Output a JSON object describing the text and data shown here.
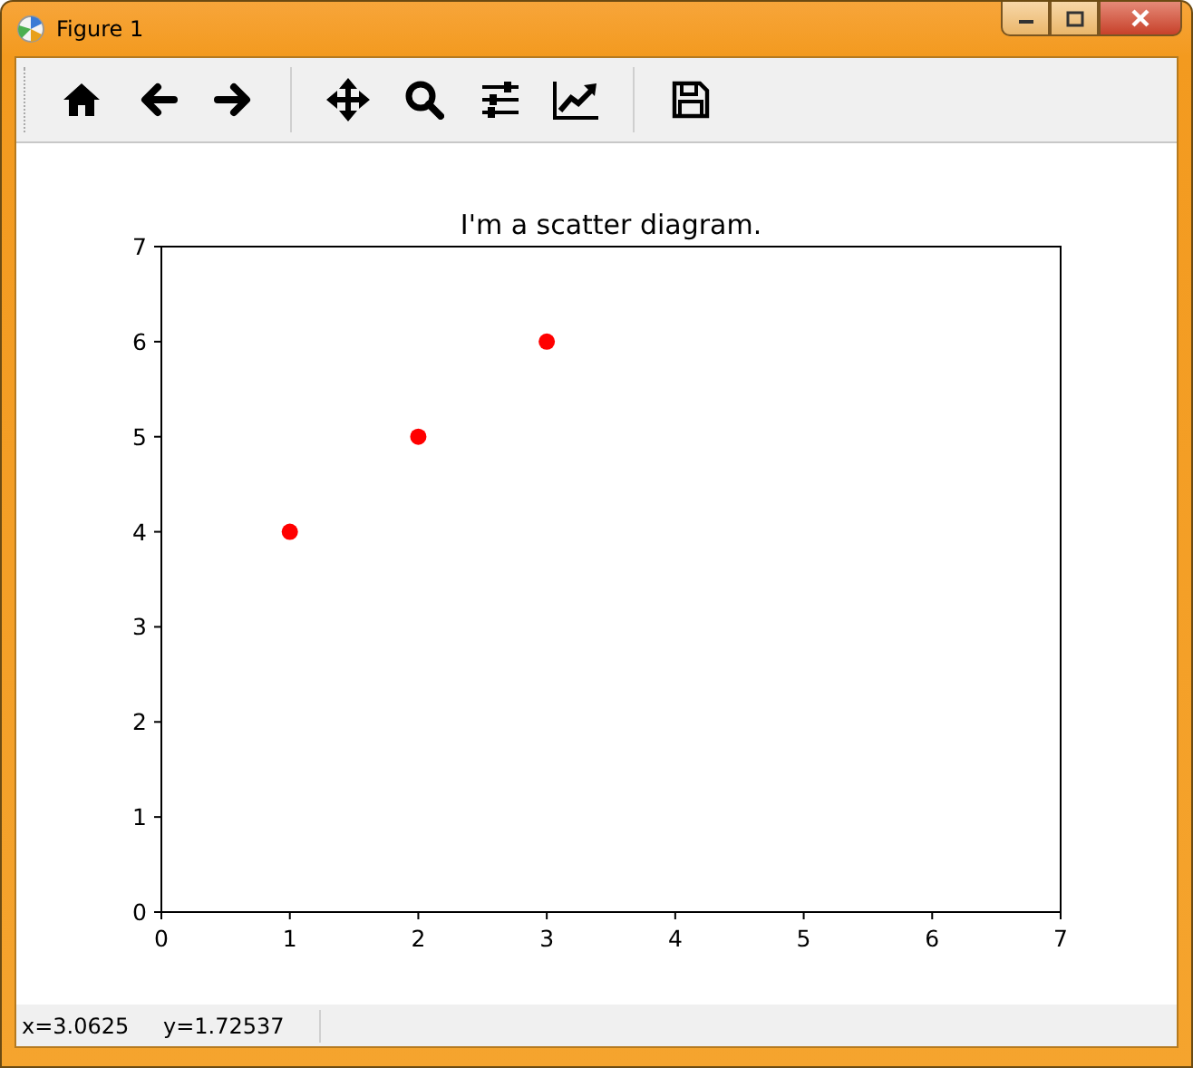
{
  "window": {
    "title": "Figure 1"
  },
  "figure": {
    "chart_data": {
      "type": "scatter",
      "title": "I'm a scatter diagram.",
      "x": [
        1,
        2,
        3
      ],
      "series": [
        {
          "color": "#ff0000",
          "values": [
            4,
            5,
            6
          ]
        }
      ],
      "xlim": [
        0,
        7
      ],
      "ylim": [
        0,
        7
      ],
      "xticks": [
        0,
        1,
        2,
        3,
        4,
        5,
        6,
        7
      ],
      "yticks": [
        0,
        1,
        2,
        3,
        4,
        5,
        6,
        7
      ]
    }
  },
  "status_bar": {
    "x_reading": "x=3.0625",
    "y_reading": "y=1.72537"
  }
}
